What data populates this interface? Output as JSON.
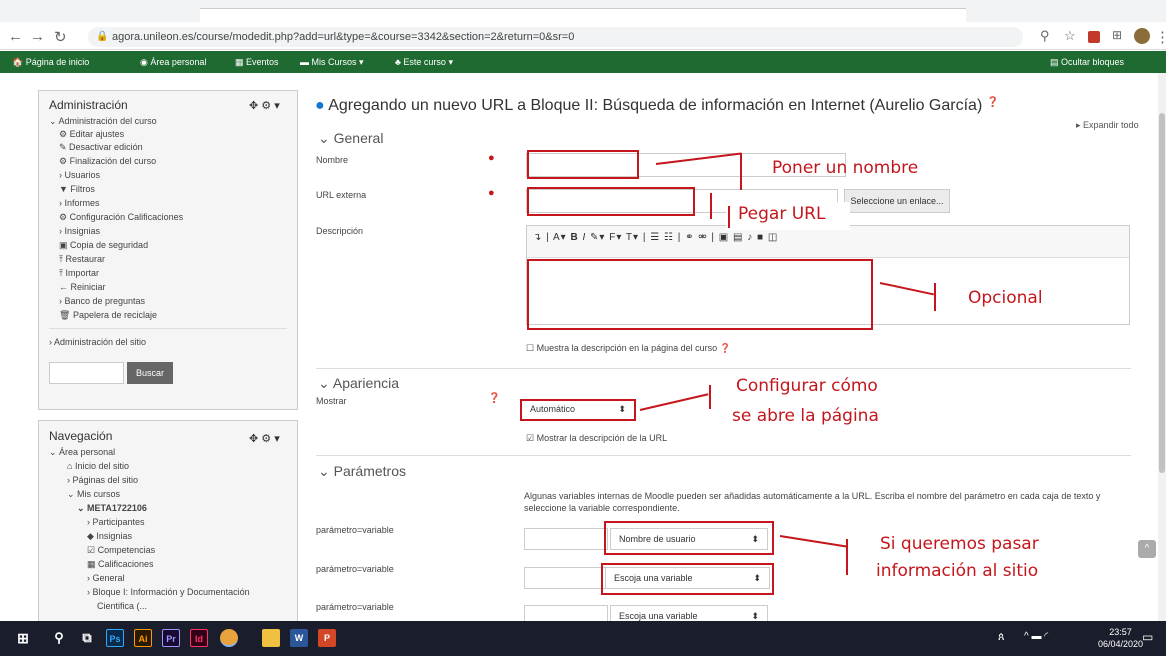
{
  "browser": {
    "url": "agora.unileon.es/course/modedit.php?add=url&type=&course=3342&section=2&return=0&sr=0"
  },
  "moodle_nav": {
    "home": "Página de inicio",
    "personal": "Área personal",
    "events": "Eventos",
    "courses": "Mis Cursos ▾",
    "this_course": "Este curso ▾",
    "hide_blocks": "Ocultar bloques"
  },
  "admin_block": {
    "title": "Administración",
    "items": [
      "Administración del curso",
      "Editar ajustes",
      "Desactivar edición",
      "Finalización del curso",
      "Usuarios",
      "Filtros",
      "Informes",
      "Configuración Calificaciones",
      "Insignias",
      "Copia de seguridad",
      "Restaurar",
      "Importar",
      "Reiniciar",
      "Banco de preguntas",
      "Papelera de reciclaje"
    ],
    "site_admin": "Administración del sitio",
    "search_button": "Buscar"
  },
  "nav_block": {
    "title": "Navegación",
    "items": [
      "Área personal",
      "Inicio del sitio",
      "Páginas del sitio",
      "Mis cursos",
      "META1722106",
      "Participantes",
      "Insignias",
      "Competencias",
      "Calificaciones",
      "General",
      "Bloque I: Información y Documentación",
      "Cientifica (..."
    ]
  },
  "main": {
    "heading": "Agregando un nuevo URL a Bloque II: Búsqueda de información en Internet (Aurelio García)",
    "expand_all": "Expandir todo",
    "general": "General",
    "name_label": "Nombre",
    "url_label": "URL externa",
    "choose_link": "Seleccione un enlace...",
    "desc_label": "Descripción",
    "show_desc": "Muestra la descripción en la página del curso",
    "appearance": "Apariencia",
    "show_label": "Mostrar",
    "show_value": "Automático",
    "show_url_desc": "Mostrar la descripción de la URL",
    "params": "Parámetros",
    "params_help": "Algunas variables internas de Moodle pueden ser añadidas automáticamente a la URL. Escriba el nombre del parámetro en cada caja de texto y seleccione la variable correspondiente.",
    "param_label": "parámetro=variable",
    "param_sel_1": "Nombre de usuario",
    "param_sel_2": "Escoja una variable",
    "param_sel_3": "Escoja una variable"
  },
  "annotations": {
    "name": "Poner un nombre",
    "url": "Pegar URL",
    "desc": "Opcional",
    "display_1": "Configurar cómo",
    "display_2": "se abre la página",
    "params_1": "Si queremos pasar",
    "params_2": "información al sitio"
  },
  "taskbar": {
    "time": "23:57",
    "date": "06/04/2020"
  },
  "colors": {
    "accent": "#1f6a31",
    "annotation": "#c4161c"
  }
}
